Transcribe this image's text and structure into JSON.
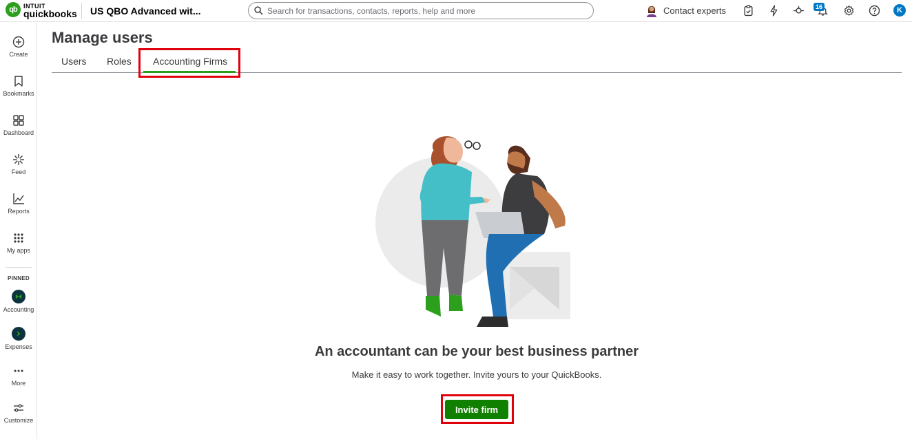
{
  "brand": {
    "intuit": "INTUIT",
    "product": "quickbooks",
    "logo_mark": "qb"
  },
  "topbar": {
    "company_name": "US QBO Advanced wit...",
    "search_placeholder": "Search for transactions, contacts, reports, help and more",
    "contact_label": "Contact experts",
    "notification_count": "16",
    "user_initial": "K"
  },
  "nav": {
    "items": [
      {
        "label": "Create",
        "icon": "plus-circle-icon"
      },
      {
        "label": "Bookmarks",
        "icon": "bookmark-icon"
      },
      {
        "label": "Dashboard",
        "icon": "dashboard-icon"
      },
      {
        "label": "Feed",
        "icon": "sparkle-icon"
      },
      {
        "label": "Reports",
        "icon": "chart-icon"
      },
      {
        "label": "My apps",
        "icon": "grid-icon"
      }
    ],
    "pinned_heading": "PINNED",
    "pinned": [
      {
        "label": "Accounting",
        "icon": "accounting-icon"
      },
      {
        "label": "Expenses",
        "icon": "expenses-icon"
      }
    ],
    "more_label": "More",
    "customize_label": "Customize"
  },
  "page": {
    "title": "Manage users",
    "tabs": [
      "Users",
      "Roles",
      "Accounting Firms"
    ],
    "active_tab": "Accounting Firms",
    "headline": "An accountant can be your best business partner",
    "subline": "Make it easy to work together. Invite yours to your QuickBooks.",
    "invite_button": "Invite firm"
  },
  "colors": {
    "brand_green": "#2ca01c",
    "button_green": "#108000",
    "highlight_red": "#e0000b",
    "accent_blue": "#0077c5"
  }
}
